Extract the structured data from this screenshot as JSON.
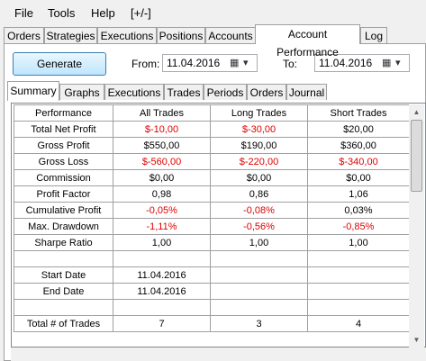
{
  "menu": [
    "File",
    "Tools",
    "Help",
    "[+/-]"
  ],
  "top_tabs": [
    {
      "label": "Orders",
      "active": false
    },
    {
      "label": "Strategies",
      "active": false
    },
    {
      "label": "Executions",
      "active": false
    },
    {
      "label": "Positions",
      "active": false
    },
    {
      "label": "Accounts",
      "active": false
    },
    {
      "label": "Account Performance",
      "active": true
    },
    {
      "label": "Log",
      "active": false
    }
  ],
  "toolbar": {
    "generate_label": "Generate",
    "from_label": "From:",
    "from_value": "11.04.2016",
    "to_label": "To:",
    "to_value": "11.04.2016"
  },
  "sub_tabs": [
    {
      "label": "Summary",
      "active": true
    },
    {
      "label": "Graphs",
      "active": false
    },
    {
      "label": "Executions",
      "active": false
    },
    {
      "label": "Trades",
      "active": false
    },
    {
      "label": "Periods",
      "active": false
    },
    {
      "label": "Orders",
      "active": false
    },
    {
      "label": "Journal",
      "active": false
    }
  ],
  "table": {
    "headers": [
      "Performance",
      "All Trades",
      "Long Trades",
      "Short Trades"
    ],
    "rows": [
      {
        "cells": [
          "Total Net Profit",
          "$-10,00",
          "$-30,00",
          "$20,00"
        ],
        "red": [
          false,
          true,
          true,
          false
        ]
      },
      {
        "cells": [
          "Gross Profit",
          "$550,00",
          "$190,00",
          "$360,00"
        ],
        "red": [
          false,
          false,
          false,
          false
        ]
      },
      {
        "cells": [
          "Gross Loss",
          "$-560,00",
          "$-220,00",
          "$-340,00"
        ],
        "red": [
          false,
          true,
          true,
          true
        ]
      },
      {
        "cells": [
          "Commission",
          "$0,00",
          "$0,00",
          "$0,00"
        ],
        "red": [
          false,
          false,
          false,
          false
        ]
      },
      {
        "cells": [
          "Profit Factor",
          "0,98",
          "0,86",
          "1,06"
        ],
        "red": [
          false,
          false,
          false,
          false
        ]
      },
      {
        "cells": [
          "Cumulative Profit",
          "-0,05%",
          "-0,08%",
          "0,03%"
        ],
        "red": [
          false,
          true,
          true,
          false
        ]
      },
      {
        "cells": [
          "Max. Drawdown",
          "-1,11%",
          "-0,56%",
          "-0,85%"
        ],
        "red": [
          false,
          true,
          true,
          true
        ]
      },
      {
        "cells": [
          "Sharpe Ratio",
          "1,00",
          "1,00",
          "1,00"
        ],
        "red": [
          false,
          false,
          false,
          false
        ]
      },
      {
        "cells": [
          "",
          "",
          "",
          ""
        ],
        "red": [
          false,
          false,
          false,
          false
        ]
      },
      {
        "cells": [
          "Start Date",
          "11.04.2016",
          "",
          ""
        ],
        "red": [
          false,
          false,
          false,
          false
        ]
      },
      {
        "cells": [
          "End Date",
          "11.04.2016",
          "",
          ""
        ],
        "red": [
          false,
          false,
          false,
          false
        ]
      },
      {
        "cells": [
          "",
          "",
          "",
          ""
        ],
        "red": [
          false,
          false,
          false,
          false
        ]
      },
      {
        "cells": [
          "Total # of Trades",
          "7",
          "3",
          "4"
        ],
        "red": [
          false,
          false,
          false,
          false
        ]
      }
    ]
  },
  "colors": {
    "loss": "#e00000",
    "accent": "#3c7fb1"
  },
  "icons": [
    "calendar-icon",
    "dropdown-arrow-icon",
    "scroll-up-icon",
    "scroll-down-icon"
  ]
}
